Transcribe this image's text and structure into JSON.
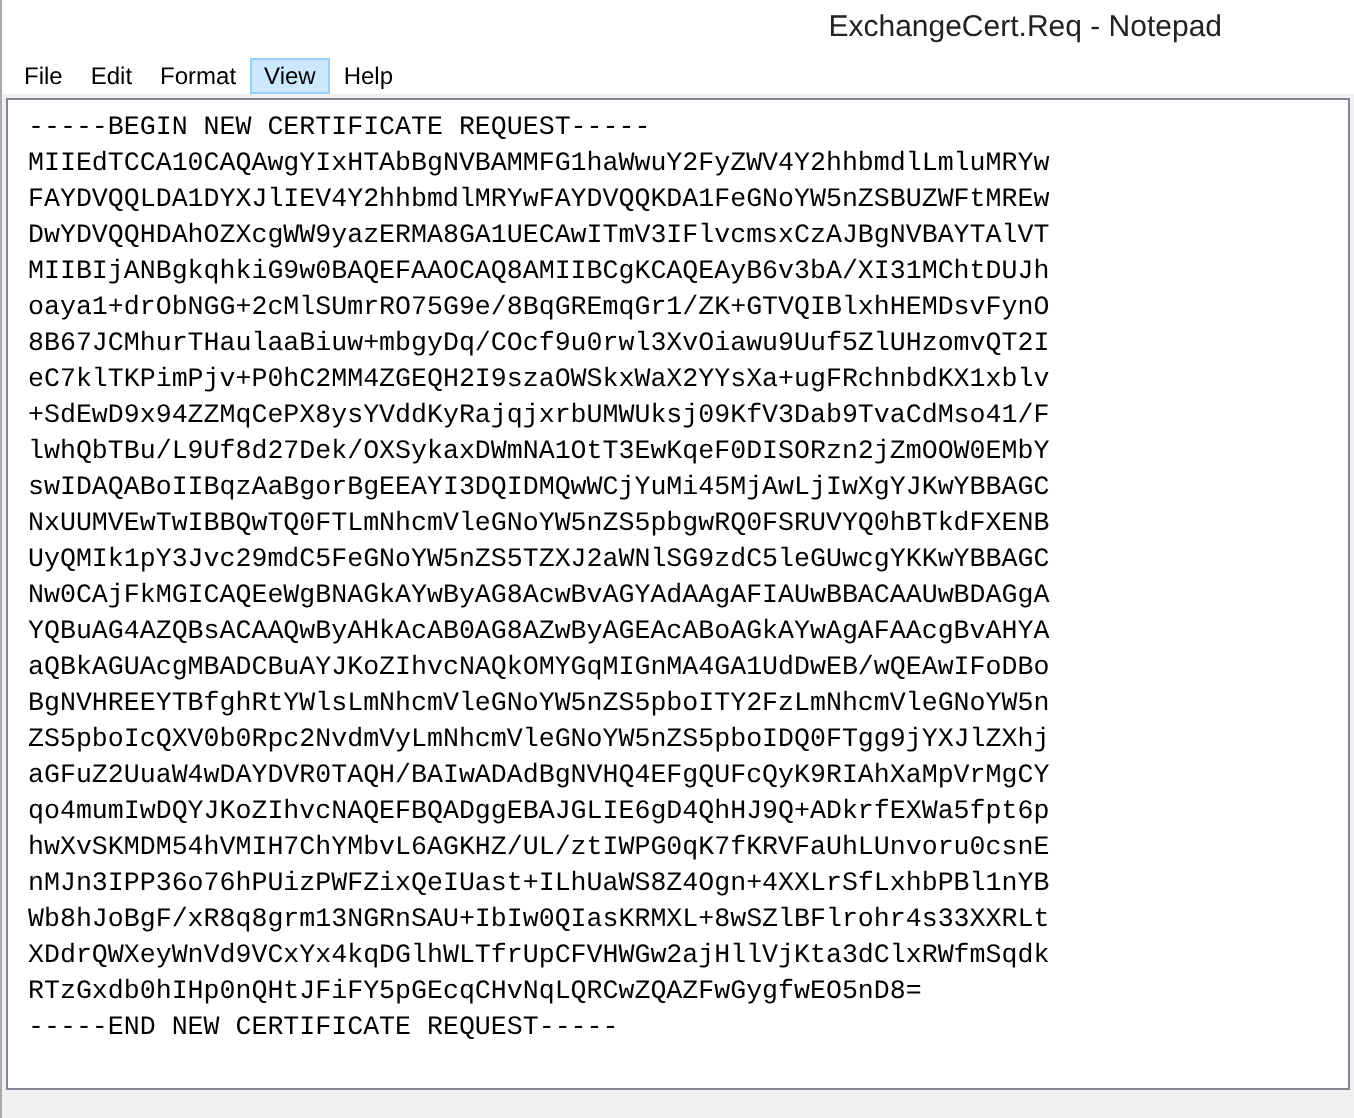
{
  "window": {
    "title": "ExchangeCert.Req - Notepad"
  },
  "menu": [
    {
      "label": "File",
      "selected": false
    },
    {
      "label": "Edit",
      "selected": false
    },
    {
      "label": "Format",
      "selected": false
    },
    {
      "label": "View",
      "selected": true
    },
    {
      "label": "Help",
      "selected": false
    }
  ],
  "editor": {
    "lines": [
      "-----BEGIN NEW CERTIFICATE REQUEST-----",
      "MIIEdTCCA10CAQAwgYIxHTAbBgNVBAMMFG1haWwuY2FyZWV4Y2hhbmdlLmluMRYw",
      "FAYDVQQLDA1DYXJlIEV4Y2hhbmdlMRYwFAYDVQQKDA1FeGNoYW5nZSBUZWFtMREw",
      "DwYDVQQHDAhOZXcgWW9yazERMA8GA1UECAwITmV3IFlvcmsxCzAJBgNVBAYTAlVT",
      "MIIBIjANBgkqhkiG9w0BAQEFAAOCAQ8AMIIBCgKCAQEAyB6v3bA/XI31MChtDUJh",
      "oaya1+drObNGG+2cMlSUmrRO75G9e/8BqGREmqGr1/ZK+GTVQIBlxhHEMDsvFynO",
      "8B67JCMhurTHaulaaBiuw+mbgyDq/COcf9u0rwl3XvOiawu9Uuf5ZlUHzomvQT2I",
      "eC7klTKPimPjv+P0hC2MM4ZGEQH2I9szaOWSkxWaX2YYsXa+ugFRchnbdKX1xblv",
      "+SdEwD9x94ZZMqCePX8ysYVddKyRajqjxrbUMWUksj09KfV3Dab9TvaCdMso41/F",
      "lwhQbTBu/L9Uf8d27Dek/OXSykaxDWmNA1OtT3EwKqeF0DISORzn2jZmOOW0EMbY",
      "swIDAQABoIIBqzAaBgorBgEEAYI3DQIDMQwWCjYuMi45MjAwLjIwXgYJKwYBBAGC",
      "NxUUMVEwTwIBBQwTQ0FTLmNhcmVleGNoYW5nZS5pbgwRQ0FSRUVYQ0hBTkdFXENB",
      "UyQMIk1pY3Jvc29mdC5FeGNoYW5nZS5TZXJ2aWNlSG9zdC5leGUwcgYKKwYBBAGC",
      "Nw0CAjFkMGICAQEeWgBNAGkAYwByAG8AcwBvAGYAdAAgAFIAUwBBACAAUwBDAGgA",
      "YQBuAG4AZQBsACAAQwByAHkAcAB0AG8AZwByAGEAcABoAGkAYwAgAFAAcgBvAHYA",
      "aQBkAGUAcgMBADCBuAYJKoZIhvcNAQkOMYGqMIGnMA4GA1UdDwEB/wQEAwIFoDBo",
      "BgNVHREEYTBfghRtYWlsLmNhcmVleGNoYW5nZS5pboITY2FzLmNhcmVleGNoYW5n",
      "ZS5pboIcQXV0b0Rpc2NvdmVyLmNhcmVleGNoYW5nZS5pboIDQ0FTgg9jYXJlZXhj",
      "aGFuZ2UuaW4wDAYDVR0TAQH/BAIwADAdBgNVHQ4EFgQUFcQyK9RIAhXaMpVrMgCY",
      "qo4mumIwDQYJKoZIhvcNAQEFBQADggEBAJGLIE6gD4QhHJ9Q+ADkrfEXWa5fpt6p",
      "hwXvSKMDM54hVMIH7ChYMbvL6AGKHZ/UL/ztIWPG0qK7fKRVFaUhLUnvoru0csnE",
      "nMJn3IPP36o76hPUizPWFZixQeIUast+ILhUaWS8Z4Ogn+4XXLrSfLxhbPBl1nYB",
      "Wb8hJoBgF/xR8q8grm13NGRnSAU+IbIw0QIasKRMXL+8wSZlBFlrohr4s33XXRLt",
      "XDdrQWXeyWnVd9VCxYx4kqDGlhWLTfrUpCFVHWGw2ajHllVjKta3dClxRWfmSqdk",
      "RTzGxdb0hIHp0nQHtJFiFY5pGEcqCHvNqLQRCwZQAZFwGygfwEO5nD8=",
      "-----END NEW CERTIFICATE REQUEST-----"
    ]
  }
}
